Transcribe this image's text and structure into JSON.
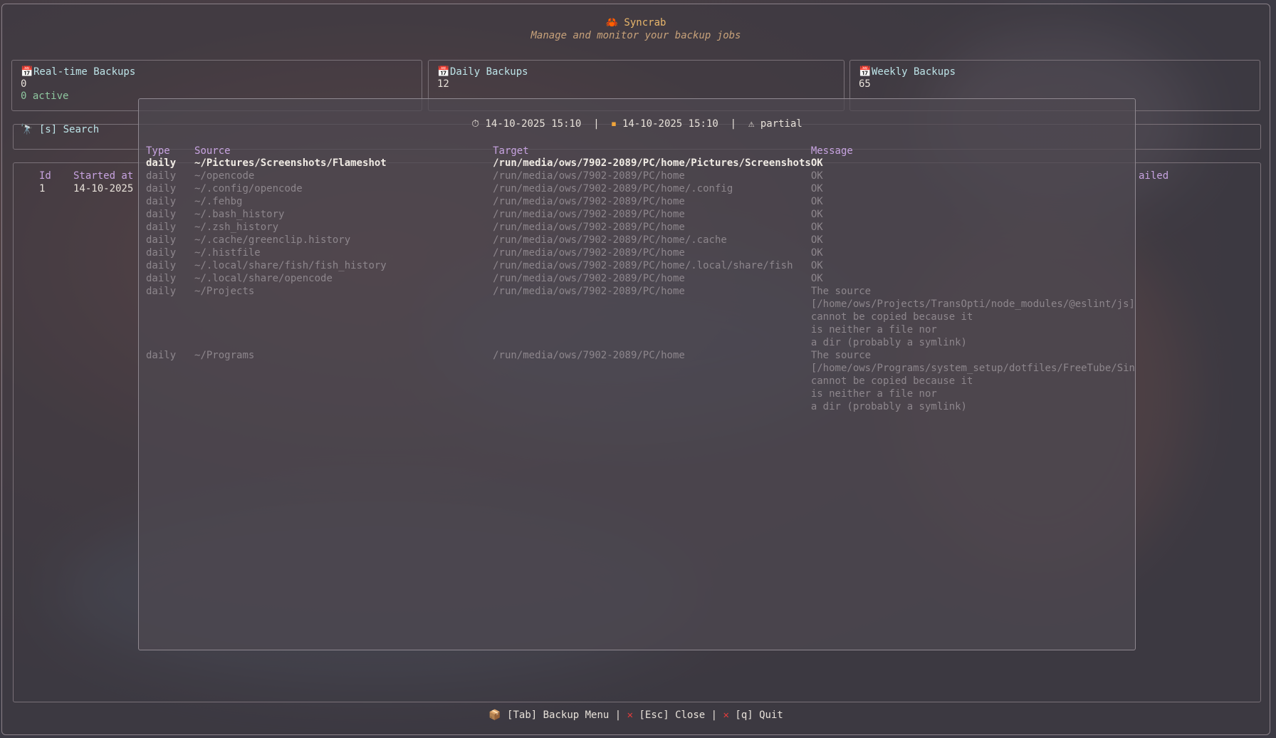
{
  "app": {
    "title": "Syncrab",
    "subtitle": "Manage and monitor your backup jobs"
  },
  "stats": [
    {
      "title": "Real-time Backups",
      "value": "0",
      "sub": "0 active"
    },
    {
      "title": "Daily Backups",
      "value": "12"
    },
    {
      "title": "Weekly Backups",
      "value": "65"
    }
  ],
  "search": {
    "label": "[s] Search"
  },
  "background_table": {
    "columns": {
      "id": "Id",
      "started": "Started at",
      "failed_fragment": "ailed"
    },
    "row": {
      "id": "1",
      "started": "14-10-2025"
    }
  },
  "modal": {
    "started": "14-10-2025 15:10",
    "finished": "14-10-2025 15:10",
    "status": "partial",
    "columns": {
      "type": "Type",
      "source": "Source",
      "target": "Target",
      "message": "Message"
    },
    "rows": [
      {
        "type": "daily",
        "source": "~/Pictures/Screenshots/Flameshot",
        "target": "/run/media/ows/7902-2089/PC/home/Pictures/Screenshots",
        "message": [
          "OK"
        ]
      },
      {
        "type": "daily",
        "source": "~/opencode",
        "target": "/run/media/ows/7902-2089/PC/home",
        "message": [
          "OK"
        ]
      },
      {
        "type": "daily",
        "source": "~/.config/opencode",
        "target": "/run/media/ows/7902-2089/PC/home/.config",
        "message": [
          "OK"
        ]
      },
      {
        "type": "daily",
        "source": "~/.fehbg",
        "target": "/run/media/ows/7902-2089/PC/home",
        "message": [
          "OK"
        ]
      },
      {
        "type": "daily",
        "source": "~/.bash_history",
        "target": "/run/media/ows/7902-2089/PC/home",
        "message": [
          "OK"
        ]
      },
      {
        "type": "daily",
        "source": "~/.zsh_history",
        "target": "/run/media/ows/7902-2089/PC/home",
        "message": [
          "OK"
        ]
      },
      {
        "type": "daily",
        "source": "~/.cache/greenclip.history",
        "target": "/run/media/ows/7902-2089/PC/home/.cache",
        "message": [
          "OK"
        ]
      },
      {
        "type": "daily",
        "source": "~/.histfile",
        "target": "/run/media/ows/7902-2089/PC/home",
        "message": [
          "OK"
        ]
      },
      {
        "type": "daily",
        "source": "~/.local/share/fish/fish_history",
        "target": "/run/media/ows/7902-2089/PC/home/.local/share/fish",
        "message": [
          "OK"
        ]
      },
      {
        "type": "daily",
        "source": "~/.local/share/opencode",
        "target": "/run/media/ows/7902-2089/PC/home",
        "message": [
          "OK"
        ]
      },
      {
        "type": "daily",
        "source": "~/Projects",
        "target": "/run/media/ows/7902-2089/PC/home",
        "message": [
          "The source",
          "[/home/ows/Projects/TransOpti/node_modules/@eslint/js]",
          "cannot be copied because it",
          "is neither a file nor",
          "a dir (probably a symlink)"
        ]
      },
      {
        "type": "daily",
        "source": "~/Programs",
        "target": "/run/media/ows/7902-2089/PC/home",
        "message": [
          "The source",
          "[/home/ows/Programs/system_setup/dotfiles/FreeTube/Sin",
          "cannot be copied because it",
          "is neither a file nor",
          "a dir (probably a symlink)"
        ]
      }
    ]
  },
  "footer": {
    "backup_menu": "[Tab] Backup Menu",
    "close": "[Esc] Close",
    "quit": "[q] Quit"
  },
  "icons": {
    "app": "crab-icon",
    "stat": "calendar-icon",
    "search": "telescope-icon",
    "start": "stopwatch-icon",
    "finish": "finish-flag-icon",
    "status": "warning-icon",
    "menu": "package-icon",
    "close": "cross-icon",
    "quit": "cross-icon"
  },
  "colors": {
    "accent_title": "#e8b66b",
    "header_purple": "#c7a3e0",
    "stat_title": "#bde4e8",
    "active_green": "#8fc7a0",
    "close_red": "#e23b3b"
  }
}
